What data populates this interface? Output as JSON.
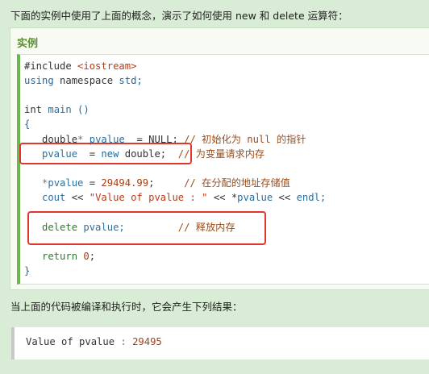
{
  "intro_text": "下面的实例中使用了上面的概念，演示了如何使用 new 和 delete 运算符：",
  "example_title": "实例",
  "code": {
    "l1_include": "#include ",
    "l1_header": "<iostream>",
    "l2_using": "using",
    "l2_namespace": " namespace ",
    "l2_std": "std;",
    "l4_int": "int",
    "l4_main": " main ",
    "l4_paren": "()",
    "l5_brace": "{",
    "l6_double": "   double",
    "l6_star": "* ",
    "l6_pvalue": "pvalue",
    "l6_eq": "  = ",
    "l6_null": "NULL;",
    "l6_comment": " // 初始化为 null 的指针",
    "l7_pvalue": "   pvalue",
    "l7_eq": "  = ",
    "l7_new": "new",
    "l7_double": " double;",
    "l7_comment": "  // 为变量请求内存",
    "l9_star": "   *",
    "l9_pvalue": "pvalue",
    "l9_eq": " = ",
    "l9_num": "29494.99",
    "l9_semi": ";",
    "l9_comment": "     // 在分配的地址存储值",
    "l10_cout": "   cout",
    "l10_op1": " << ",
    "l10_str": "\"Value of pvalue : \"",
    "l10_op2": " << *",
    "l10_pvalue": "pvalue",
    "l10_op3": " << ",
    "l10_endl": "endl;",
    "l12_delete": "   delete",
    "l12_pvalue": " pvalue;",
    "l12_comment": "         // 释放内存",
    "l14_return": "   return",
    "l14_zero": " 0",
    "l14_semi": ";",
    "l15_brace": "}"
  },
  "outro_text": "当上面的代码被编译和执行时，它会产生下列结果：",
  "output": {
    "label": "Value of pvalue ",
    "colon": ":",
    "value": " 29495"
  },
  "colors": {
    "page_bg": "#d9ecd5",
    "title_green": "#5e8e32",
    "highlight_red": "#e0362c"
  }
}
